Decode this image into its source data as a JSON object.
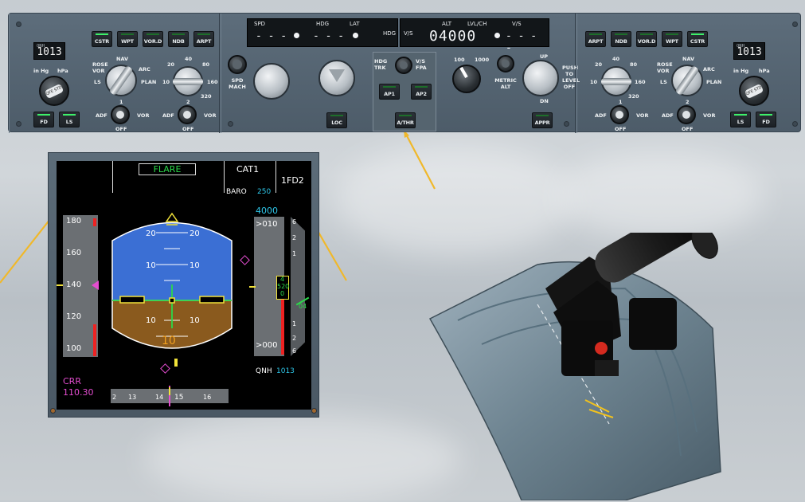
{
  "fcu": {
    "left_efis": {
      "qnh_label": "QNH",
      "qnh_value": "1013",
      "buttons": [
        "CSTR",
        "WPT",
        "VOR.D",
        "NDB",
        "ARPT"
      ],
      "baro_units": [
        "in Hg",
        "hPa"
      ],
      "baro_knob": "QFE STD",
      "fd_button": "FD",
      "ls_button": "LS",
      "mode_labels": [
        "ROSE",
        "NAV",
        "ARC",
        "PLAN",
        "VOR",
        "LS"
      ],
      "range_labels": [
        "20",
        "40",
        "80",
        "10",
        "160",
        "320"
      ],
      "adf_vor": [
        "ADF",
        "VOR",
        "OFF",
        "1",
        "2"
      ]
    },
    "fcu_center": {
      "spd_label": "SPD",
      "hdg_label": "HDG",
      "lat_label": "LAT",
      "hdg_vs_label": "HDG",
      "vs_label": "V/S",
      "spd_value": "- - -",
      "hdg_value": "- - -",
      "alt_label": "ALT",
      "lvl_ch_label": "LVL/CH",
      "vs2_label": "V/S",
      "alt_value": "04000",
      "vs_value": "- - - -",
      "spd_mach": "SPD MACH",
      "hdg_trk": "HDG TRK",
      "vs_fpa": "V/S FPA",
      "ap1": "AP1",
      "ap2": "AP2",
      "athr": "A/THR",
      "loc": "LOC",
      "appr": "APPR",
      "metric_alt": "METRIC ALT",
      "alt_100": "100",
      "alt_1000": "1000",
      "up": "UP",
      "dn": "DN",
      "push_level_off": "PUSH TO LEVEL OFF"
    },
    "right_efis": {
      "qnh_label": "QNH",
      "qnh_value": "1013",
      "buttons": [
        "ARPT",
        "NDB",
        "VOR.D",
        "WPT",
        "CSTR"
      ],
      "fd_button": "FD",
      "ls_button": "LS"
    }
  },
  "pfd": {
    "fma_center": "FLARE",
    "fma_cat": "CAT1",
    "fma_fd": "1FD2",
    "baro_label": "BARO",
    "baro_value": "250",
    "speed_ticks": [
      "180",
      "160",
      "140",
      "120",
      "100"
    ],
    "pitch_marks": [
      "20",
      "10",
      "10",
      "20"
    ],
    "alt_target": "4000",
    "alt_top": ">010",
    "alt_bottom": ">000",
    "alt_box_hi": "4",
    "alt_box_mid": "520",
    "alt_box_lo": "0",
    "vs_marks": [
      "6",
      "2",
      "1",
      "1",
      "2",
      "6"
    ],
    "vs_value": "04",
    "radio_alt": "10",
    "qnh_label": "QNH",
    "qnh_value": "1013",
    "ils_ident": "CRR",
    "ils_freq": "110.30",
    "heading_ticks": [
      "2",
      "13",
      "14",
      "15",
      "16"
    ],
    "colors": {
      "green": "#2bd94a",
      "cyan": "#2ec6e8",
      "magenta": "#e44dd0",
      "yellow": "#f2e33a",
      "sky": "#3b6fd4",
      "ground": "#8a5a1e"
    }
  }
}
